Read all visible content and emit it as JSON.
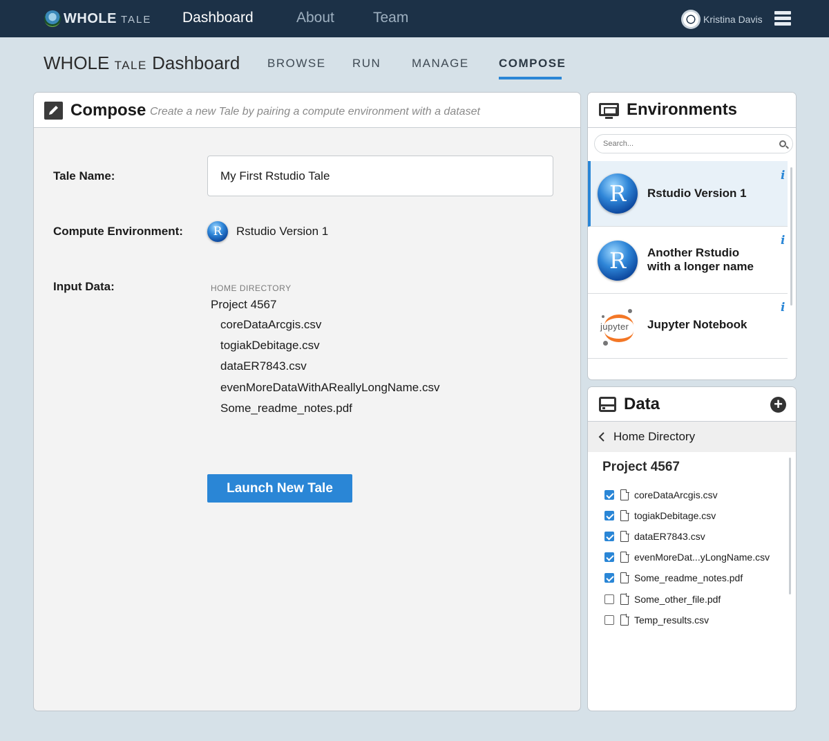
{
  "brand": {
    "whole": "WHOLE",
    "tale": "TALE"
  },
  "nav": {
    "dashboard": "Dashboard",
    "about": "About",
    "team": "Team"
  },
  "user": {
    "name": "Kristina Davis"
  },
  "subheader": {
    "title_whole": "WHOLE",
    "title_tale": "TALE",
    "title_rest": "Dashboard",
    "tabs": [
      "BROWSE",
      "RUN",
      "MANAGE",
      "COMPOSE"
    ],
    "active_tab": "COMPOSE"
  },
  "compose": {
    "title": "Compose",
    "subtitle": "Create a new Tale by pairing a compute environment with a dataset",
    "tale_name_label": "Tale Name:",
    "tale_name_value": "My First Rstudio Tale",
    "compute_env_label": "Compute Environment:",
    "compute_env_value": "Rstudio Version 1",
    "input_data_label": "Input Data:",
    "home_directory": "HOME DIRECTORY",
    "project": "Project 4567",
    "files": [
      "coreDataArcgis.csv",
      "togiakDebitage.csv",
      "dataER7843.csv",
      "evenMoreDataWithAReallyLongName.csv",
      "Some_readme_notes.pdf"
    ],
    "launch_button": "Launch New Tale"
  },
  "environments": {
    "title": "Environments",
    "search_placeholder": "Search...",
    "items": [
      {
        "name": "Rstudio Version 1",
        "logo": "R",
        "selected": true
      },
      {
        "name_line1": "Another Rstudio",
        "name_line2": "with a longer name",
        "logo": "R",
        "selected": false
      },
      {
        "name": "Jupyter Notebook",
        "logo": "jupyter",
        "selected": false
      }
    ],
    "info": "i"
  },
  "data_panel": {
    "title": "Data",
    "breadcrumb": "Home Directory",
    "project": "Project 4567",
    "files": [
      {
        "name": "coreDataArcgis.csv",
        "checked": true,
        "type": "file"
      },
      {
        "name": "togiakDebitage.csv",
        "checked": true,
        "type": "file"
      },
      {
        "name": "dataER7843.csv",
        "checked": true,
        "type": "file"
      },
      {
        "name": "evenMoreDat...yLongName.csv",
        "checked": true,
        "type": "file"
      },
      {
        "name": "Some_readme_notes.pdf",
        "checked": true,
        "type": "pdf"
      },
      {
        "name": "Some_other_file.pdf",
        "checked": false,
        "type": "pdf"
      },
      {
        "name": "Temp_results.csv",
        "checked": false,
        "type": "file"
      }
    ]
  },
  "colors": {
    "topbar": "#1c3147",
    "accent": "#2a86d6",
    "background": "#d6e1e8"
  }
}
